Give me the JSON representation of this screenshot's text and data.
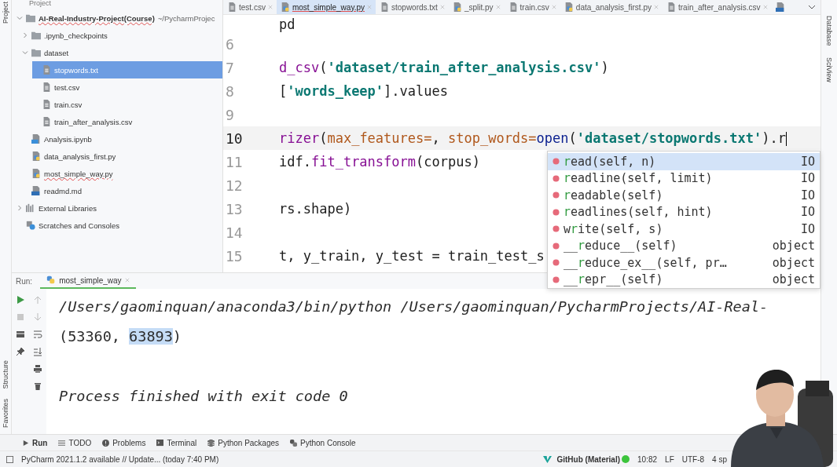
{
  "left_stripe": {
    "top": [
      {
        "label": "Project"
      }
    ],
    "bottom": [
      {
        "label": "Structure"
      },
      {
        "label": "Favorites"
      }
    ]
  },
  "right_stripe": [
    {
      "label": "Database"
    },
    {
      "label": "SciView"
    }
  ],
  "project": {
    "title": "Project",
    "tree": [
      {
        "label": "AI-Real-Industry-Project(Course)",
        "suffix": "~/PycharmProjec",
        "kind": "root",
        "expanded": true,
        "selected": false,
        "underlined": true,
        "children": [
          {
            "label": ".ipynb_checkpoints",
            "kind": "folder",
            "expanded": false,
            "selected": false,
            "underlined": false
          },
          {
            "label": "dataset",
            "kind": "folder",
            "expanded": true,
            "selected": false,
            "underlined": false,
            "children": [
              {
                "label": "stopwords.txt",
                "kind": "file",
                "selected": true,
                "underlined": false
              },
              {
                "label": "test.csv",
                "kind": "file",
                "selected": false,
                "underlined": false
              },
              {
                "label": "train.csv",
                "kind": "file",
                "selected": false,
                "underlined": false
              },
              {
                "label": "train_after_analysis.csv",
                "kind": "file",
                "selected": false,
                "underlined": false
              }
            ]
          },
          {
            "label": "Analysis.ipynb",
            "kind": "notebook",
            "selected": false,
            "underlined": false
          },
          {
            "label": "data_analysis_first.py",
            "kind": "python",
            "selected": false,
            "underlined": false
          },
          {
            "label": "most_simple_way.py",
            "kind": "python",
            "selected": false,
            "underlined": true
          },
          {
            "label": "readmd.md",
            "kind": "markdown",
            "selected": false,
            "underlined": false
          }
        ]
      },
      {
        "label": "External Libraries",
        "kind": "library",
        "expanded": false,
        "selected": false,
        "underlined": false
      },
      {
        "label": "Scratches and Consoles",
        "kind": "scratch",
        "selected": false,
        "underlined": false
      }
    ]
  },
  "tabs": [
    {
      "label": "test.csv",
      "kind": "file",
      "selected": false
    },
    {
      "label": "most_simple_way.py",
      "kind": "python",
      "selected": true
    },
    {
      "label": "stopwords.txt",
      "kind": "file",
      "selected": false
    },
    {
      "label": "_split.py",
      "kind": "python",
      "selected": false
    },
    {
      "label": "train.csv",
      "kind": "file",
      "selected": false
    },
    {
      "label": "data_analysis_first.py",
      "kind": "python",
      "selected": false
    },
    {
      "label": "train_after_analysis.csv",
      "kind": "file",
      "selected": false
    },
    {
      "kind": "markdown",
      "selected": false
    }
  ],
  "editor": {
    "lines": [
      {
        "tokens": [
          {
            "kind": "text",
            "text": "pd"
          }
        ],
        "current": false
      },
      {
        "number": "6",
        "current": false
      },
      {
        "number": "7",
        "current": false,
        "tokens": [
          {
            "kind": "call",
            "text": "d_csv"
          },
          {
            "kind": "text",
            "text": "("
          },
          {
            "kind": "string",
            "text": "'dataset/train_after_analysis.csv'"
          },
          {
            "kind": "text",
            "text": ")"
          }
        ]
      },
      {
        "number": "8",
        "current": false,
        "tokens": [
          {
            "kind": "text",
            "text": "["
          },
          {
            "kind": "string",
            "text": "'words_keep'"
          },
          {
            "kind": "text",
            "text": "].values"
          }
        ]
      },
      {
        "number": "9",
        "current": false
      },
      {
        "number": "10",
        "current": true,
        "tokens": [
          {
            "kind": "call",
            "text": "rizer"
          },
          {
            "kind": "text",
            "text": "("
          },
          {
            "kind": "param",
            "text": "max_features="
          },
          {
            "kind": "text",
            "text": ", "
          },
          {
            "kind": "param",
            "text": "stop_words="
          },
          {
            "kind": "builtin",
            "text": "open"
          },
          {
            "kind": "text",
            "text": "("
          },
          {
            "kind": "string",
            "text": "'dataset/stopwords.txt'"
          },
          {
            "kind": "text",
            "text": ").r"
          }
        ]
      },
      {
        "number": "11",
        "current": false,
        "tokens": [
          {
            "kind": "text",
            "text": "idf."
          },
          {
            "kind": "call",
            "text": "fit_transform"
          },
          {
            "kind": "text",
            "text": "(corpus)"
          }
        ]
      },
      {
        "number": "12",
        "current": false
      },
      {
        "number": "13",
        "current": false,
        "tokens": [
          {
            "kind": "text",
            "text": "rs.shape)"
          }
        ]
      },
      {
        "number": "14",
        "current": false
      },
      {
        "number": "15",
        "current": false,
        "tokens": [
          {
            "kind": "text",
            "text": "t, y_train, y_test = train_test_s"
          }
        ]
      }
    ],
    "completion": [
      {
        "match": "r",
        "rest": "ead(self, n)",
        "type": "IO",
        "selected": true
      },
      {
        "match": "r",
        "rest": "eadline(self, limit)",
        "type": "IO",
        "selected": false
      },
      {
        "match": "r",
        "rest": "eadable(self)",
        "type": "IO",
        "selected": false
      },
      {
        "match": "r",
        "rest": "eadlines(self, hint)",
        "type": "IO",
        "selected": false
      },
      {
        "prefix": "w",
        "match": "r",
        "rest": "ite(self, s)",
        "type": "IO",
        "selected": false
      },
      {
        "prefix": "__",
        "match": "r",
        "rest": "educe__(self)",
        "type": "object",
        "selected": false
      },
      {
        "prefix": "__",
        "match": "r",
        "rest": "educe_ex__(self, pr…",
        "type": "object",
        "selected": false
      },
      {
        "prefix": "__",
        "match": "r",
        "rest": "epr__(self)",
        "type": "object",
        "selected": false
      }
    ]
  },
  "run": {
    "label": "Run:",
    "tab": "most_simple_way",
    "output": [
      {
        "kind": "command",
        "segments": [
          {
            "text": "/Users/gaominquan/anaconda3/bin/python /Users/gaominquan/PycharmProjects/AI-Real-",
            "selected": false
          }
        ]
      },
      {
        "kind": "output",
        "segments": [
          {
            "text": "(53360, ",
            "selected": false
          },
          {
            "text": "63893",
            "selected": true
          },
          {
            "text": ")",
            "selected": false
          }
        ]
      },
      {
        "kind": "exit",
        "segments": [
          {
            "text": "Process finished with exit code 0",
            "selected": false
          }
        ]
      }
    ]
  },
  "tool_windows": [
    {
      "label": "Run",
      "kind": "run"
    },
    {
      "label": "TODO",
      "kind": "todo"
    },
    {
      "label": "Problems",
      "kind": "problems"
    },
    {
      "label": "Terminal",
      "kind": "terminal"
    },
    {
      "label": "Python Packages",
      "kind": "packages"
    },
    {
      "label": "Python Console",
      "kind": "console"
    }
  ],
  "status_bar": {
    "message": "PyCharm 2021.1.2 available // Update... (today 7:40 PM)",
    "theme": "GitHub (Material)",
    "position": "10:82",
    "line_ending": "LF",
    "encoding": "UTF-8",
    "indent": "4 sp"
  }
}
